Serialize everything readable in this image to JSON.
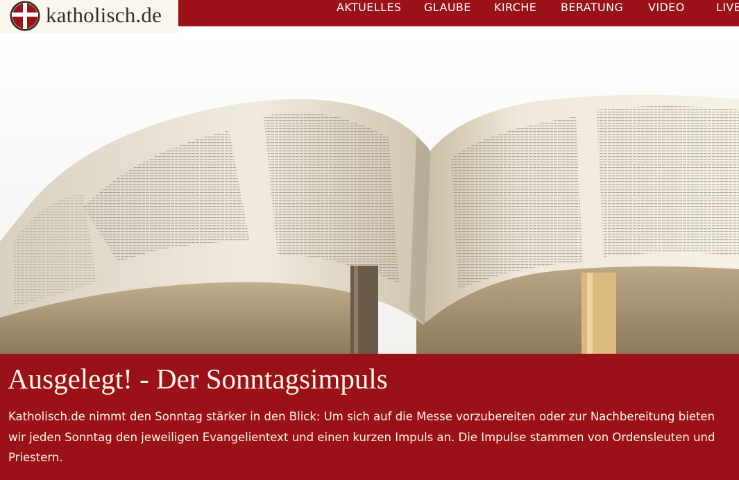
{
  "site": {
    "logo_text": "katholisch.de",
    "logo_icon": "cross-circle-icon"
  },
  "nav": {
    "items": [
      "AKTUELLES",
      "GLAUBE",
      "KIRCHE",
      "BERATUNG",
      "VIDEO",
      "LIVE"
    ]
  },
  "hero": {
    "image": "open-bible-photo"
  },
  "article": {
    "title": "Ausgelegt! - Der Sonntagsimpuls",
    "body": "Katholisch.de nimmt den Sonntag stärker in den Blick: Um sich auf die Messe vorzubereiten oder zur Nachbereitung bieten wir jeden Sonntag den jeweiligen Evangelientext und einen kurzen Impuls an. Die Impulse stammen von Ordensleuten und Priestern."
  },
  "colors": {
    "brand_red": "#9b1118",
    "logo_bg": "#fbf6ee",
    "text_light": "#fff6ec"
  }
}
